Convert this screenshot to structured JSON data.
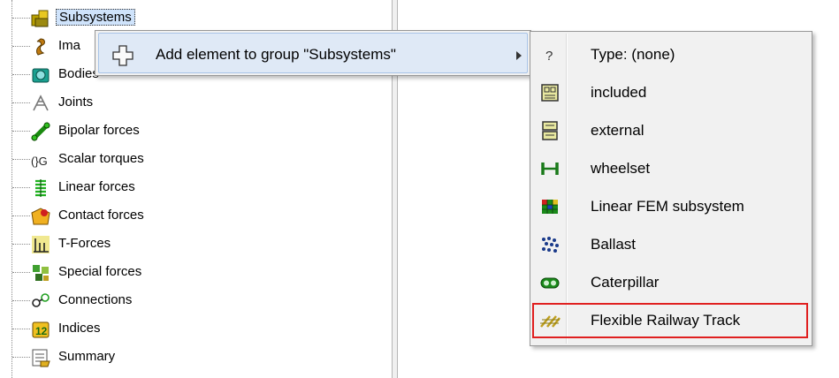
{
  "tree": {
    "items": [
      {
        "label": "Subsystems",
        "icon": "subsystems-icon",
        "selected": true
      },
      {
        "label": "Ima",
        "icon": "image-icon"
      },
      {
        "label": "Bodies",
        "icon": "bodies-icon"
      },
      {
        "label": "Joints",
        "icon": "joints-icon"
      },
      {
        "label": "Bipolar forces",
        "icon": "bipolar-forces-icon"
      },
      {
        "label": "Scalar torques",
        "icon": "scalar-torques-icon"
      },
      {
        "label": "Linear forces",
        "icon": "linear-forces-icon"
      },
      {
        "label": "Contact forces",
        "icon": "contact-forces-icon"
      },
      {
        "label": "T-Forces",
        "icon": "t-forces-icon"
      },
      {
        "label": "Special forces",
        "icon": "special-forces-icon"
      },
      {
        "label": "Connections",
        "icon": "connections-icon"
      },
      {
        "label": "Indices",
        "icon": "indices-icon"
      },
      {
        "label": "Summary",
        "icon": "summary-icon"
      }
    ]
  },
  "context_menu": {
    "item_label": "Add element to group \"Subsystems\"",
    "icon": "plus-icon"
  },
  "submenu": {
    "items": [
      {
        "label": "Type: (none)",
        "icon": "question-icon"
      },
      {
        "label": "included",
        "icon": "included-icon"
      },
      {
        "label": "external",
        "icon": "external-icon"
      },
      {
        "label": "wheelset",
        "icon": "wheelset-icon"
      },
      {
        "label": "Linear FEM subsystem",
        "icon": "fem-icon"
      },
      {
        "label": "Ballast",
        "icon": "ballast-icon"
      },
      {
        "label": "Caterpillar",
        "icon": "caterpillar-icon"
      },
      {
        "label": "Flexible Railway Track",
        "icon": "railway-track-icon",
        "highlighted": true
      }
    ]
  },
  "colors": {
    "selection": "#cfe3fb",
    "menu_background": "#f1f1f1",
    "highlight_border": "#e02020"
  }
}
